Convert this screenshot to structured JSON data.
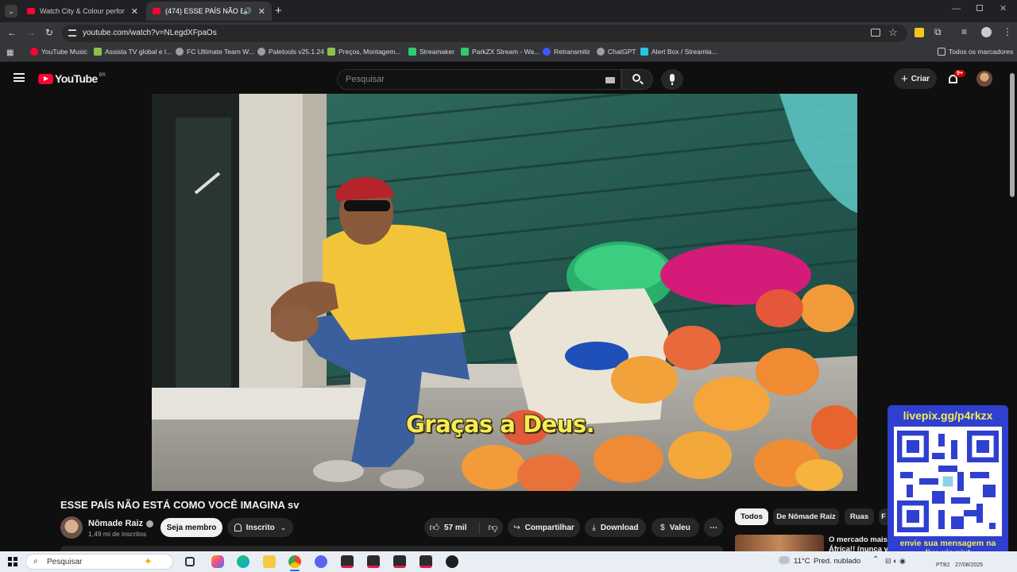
{
  "browser": {
    "tabs": [
      {
        "title": "Watch City & Colour perform th",
        "active": false
      },
      {
        "title": "(474) ESSE PAÍS NÃO ESTÁ",
        "active": true
      }
    ],
    "url": "youtube.com/watch?v=NLegdXFpaOs",
    "bookmarks": [
      {
        "label": "YouTube Music",
        "color": "#ff0033"
      },
      {
        "label": "Assista TV global e l...",
        "color": "#8bc34a"
      },
      {
        "label": "FC Ultimate Team W...",
        "color": "#9e9e9e"
      },
      {
        "label": "Paletools v25.1.24",
        "color": "#9e9e9e"
      },
      {
        "label": "Preços, Montagem...",
        "color": "#8bc34a"
      },
      {
        "label": "Streamaker",
        "color": "#2ecc71"
      },
      {
        "label": "ParkZX Stream - Wa...",
        "color": "#2ecc71"
      },
      {
        "label": "Retransmitir",
        "color": "#3d5afe"
      },
      {
        "label": "ChatGPT",
        "color": "#9e9e9e"
      },
      {
        "label": "Alert Box / Streamla...",
        "color": "#26c6da"
      }
    ],
    "all_bookmarks": "Todos os marcadores"
  },
  "youtube": {
    "logo": "YouTube",
    "region": "BR",
    "search_placeholder": "Pesquisar",
    "create_label": "Criar",
    "notif_count": "9+",
    "subtitle": "Graças a Deus.",
    "video_title": "ESSE PAÍS NÃO ESTÁ COMO VOCÊ IMAGINA sv",
    "channel": {
      "name": "Nômade Raiz",
      "subscribers": "1,49 mi de inscritos"
    },
    "member_button": "Seja membro",
    "subscribed_button": "Inscrito",
    "likes": "57 mil",
    "share": "Compartilhar",
    "download": "Download",
    "thanks": "Valeu",
    "chips": [
      "Todos",
      "De Nômade Raiz",
      "Ruas",
      "F"
    ],
    "rec_title_line1": "O mercado mais E",
    "rec_title_line2": "África!! (nunca vi"
  },
  "overlay": {
    "top_text": "livepix.gg/p4rkzx",
    "bottom_text_line1": "envie sua mensagem na",
    "bottom_text_line2": "live via pix!"
  },
  "taskbar": {
    "search": "Pesquisar",
    "weather_temp": "11°C",
    "weather_desc": "Pred. nublado",
    "lang": "PTB2",
    "date": "27/08/2025"
  }
}
